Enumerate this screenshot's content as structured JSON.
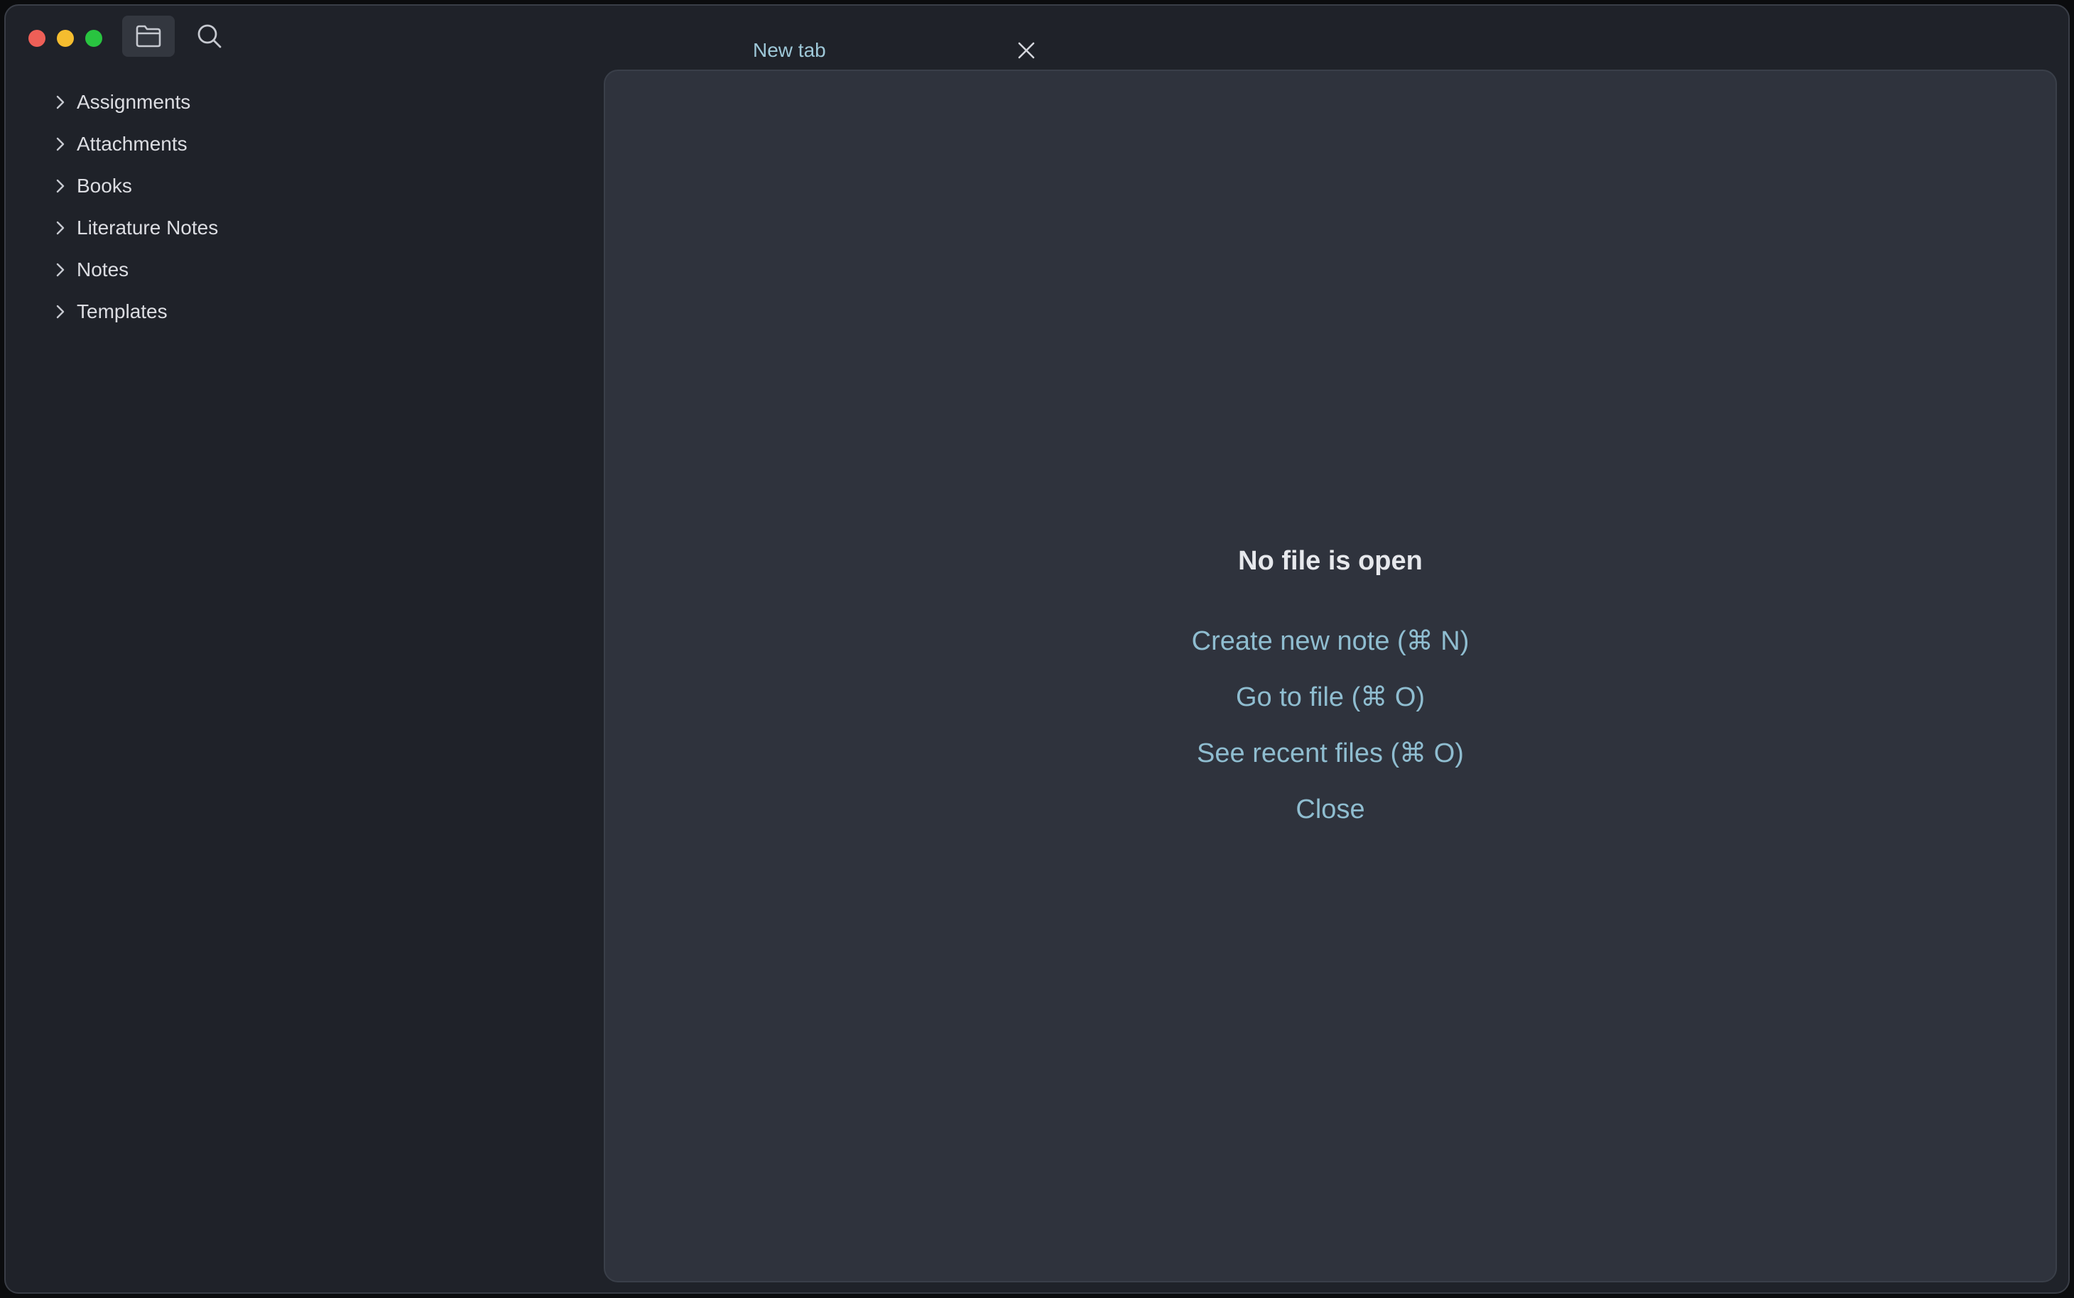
{
  "sidebar": {
    "folders": [
      {
        "label": "Assignments"
      },
      {
        "label": "Attachments"
      },
      {
        "label": "Books"
      },
      {
        "label": "Literature Notes"
      },
      {
        "label": "Notes"
      },
      {
        "label": "Templates"
      }
    ]
  },
  "tabs": [
    {
      "title": "New tab"
    }
  ],
  "empty_state": {
    "title": "No file is open",
    "actions": [
      {
        "label": "Create new note (⌘ N)"
      },
      {
        "label": "Go to file (⌘ O)"
      },
      {
        "label": "See recent files (⌘ O)"
      },
      {
        "label": "Close"
      }
    ]
  },
  "colors": {
    "sidebar_bg": "#1f2229",
    "editor_bg": "#2f333d",
    "accent": "#8fbdd0",
    "text": "#dcdde2"
  },
  "icons": {
    "ribbon": [
      "folder-icon",
      "search-icon"
    ],
    "tab_close": "close-icon",
    "tree_chevron": "chevron-right-icon"
  }
}
